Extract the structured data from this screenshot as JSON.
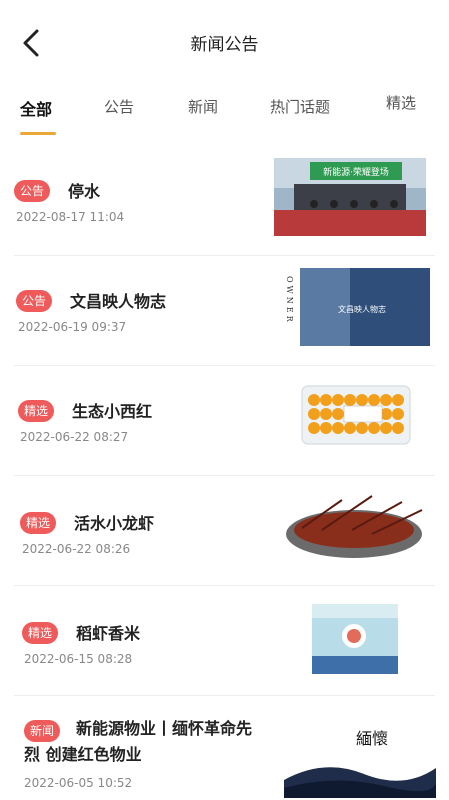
{
  "header": {
    "title": "新闻公告"
  },
  "tabs": [
    {
      "label": "全部"
    },
    {
      "label": "公告"
    },
    {
      "label": "新闻"
    },
    {
      "label": "热门话题"
    },
    {
      "label": "精选"
    }
  ],
  "items": [
    {
      "badge": "公告",
      "title": "停水",
      "date": "2022-08-17 11:04",
      "thumb_text": "新能源·荣耀登场"
    },
    {
      "badge": "公告",
      "title": "文昌映人物志",
      "date": "2022-06-19 09:37",
      "thumb_text": "OWNER",
      "thumb_sub": "文昌映人物志"
    },
    {
      "badge": "精选",
      "title": "生态小西红",
      "date": "2022-06-22 08:27"
    },
    {
      "badge": "精选",
      "title": "活水小龙虾",
      "date": "2022-06-22 08:26"
    },
    {
      "badge": "精选",
      "title": "稻虾香米",
      "date": "2022-06-15 08:28"
    },
    {
      "badge": "新闻",
      "title": "新能源物业丨缅怀革命先烈 创建红色物业",
      "date": "2022-06-05 10:52",
      "thumb_text": "緬懷"
    }
  ],
  "colors": {
    "accent": "#e8a93a",
    "badge": "#ef5a5a"
  }
}
